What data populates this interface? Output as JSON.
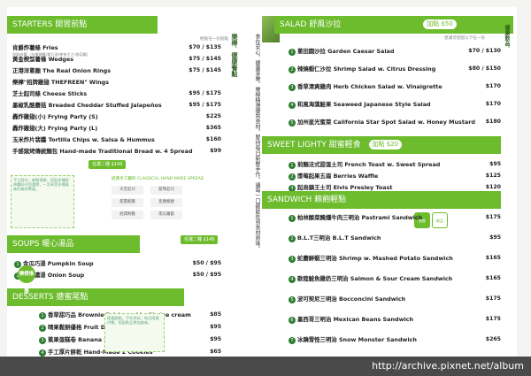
{
  "footer_url": "http://archive.pixnet.net/album",
  "left": {
    "starters": {
      "title": "STARTERS 開胃前點",
      "side_note": "輕點任一份點點",
      "items": [
        {
          "name": "肯爵炸薯條",
          "en": "Fries",
          "price": "$70 / $135",
          "desc": "加點肉醬（辛辣辣醬/美乃滋/麥香主之/香蒜醬）"
        },
        {
          "name": "黃金楔型薯條",
          "en": "Wedges",
          "price": "$75 / $145"
        },
        {
          "name": "正港洋蔥圈",
          "en": "The Real Onion Rings",
          "price": "$75 / $145"
        },
        {
          "name": "樂檸\"招牌雞翅 THEFREEN\" Wings",
          "en": "",
          "price": ""
        },
        {
          "name": "芝士起司條",
          "en": "Cheese Sticks",
          "price": "$95 / $175"
        },
        {
          "name": "墨椒乳酪蘑菇",
          "en": "Breaded Cheddar Stuffed Jalapeños",
          "price": "$95 / $175"
        },
        {
          "name": "轟炸雞翅(小)",
          "en": "Frying Party (S)",
          "price": "$225"
        },
        {
          "name": "轟炸雞翅(大)",
          "en": "Frying Party (L)",
          "price": "$365"
        },
        {
          "name": "玉米炸片翡醬",
          "en": "Tortilla Chips w. Salsa & Hummus",
          "price": "$160"
        },
        {
          "name": "手感窯烤傳統麵包",
          "en": "Hand-made Traditional Bread w. 4 Spread",
          "price": "$99"
        }
      ],
      "combo_label": "任選二種 $149"
    },
    "sauces": {
      "title": "經典手工醬料 CLASSICAL HAND-MADE SPREAD",
      "list": [
        "天堂起司",
        "藍莓起司",
        "甜薑藍醬",
        "焦糖楓糖",
        "經典鮮醬",
        "南瓜蘿蔔"
      ]
    },
    "soups": {
      "title": "SOUPS 暖心湯品",
      "combo_label": "任選二種 $149",
      "items": [
        {
          "name": "金瓜巧湯",
          "en": "Pumpkin Soup",
          "price": "$50 / $95"
        },
        {
          "name": "洋蔥濃湯",
          "en": "Onion Soup",
          "price": "$50 / $95"
        }
      ]
    },
    "desserts": {
      "title": "DESSERTS 搪蜜尾點",
      "items": [
        {
          "name": "香草甜巧品",
          "en": "Brownie Bricks w. Vanilla Ice cream",
          "price": "$85"
        },
        {
          "name": "晴果鬆餅優格",
          "en": "Fruit Dish w. Yogurt",
          "price": "$95"
        },
        {
          "name": "蕉果蛋糕卷",
          "en": "Banana Pound Cake",
          "price": "$95"
        },
        {
          "name": "手工厚片餅乾",
          "en": "Hand-Made 2 Cookies",
          "price": "$65"
        }
      ]
    },
    "badge": "樂檸推薦",
    "page_number": "1"
  },
  "vertical": {
    "title": "樂檸．健康餐點",
    "text": "食在安心，健康享樂。樂檸精選優質食材，堅持每日新鮮手作，讓每一口都能吃到食材原味。"
  },
  "right": {
    "salad": {
      "title": "SALAD 舒風沙拉",
      "combo_label": "加點 $50",
      "side_note": "建議可搭配以下任一份",
      "items": [
        {
          "name": "蔥田園沙拉",
          "en": "Garden Caesar Salad",
          "price": "$70 / $130"
        },
        {
          "name": "辣燒蝦仁沙拉",
          "en": "Shrimp Salad w. Citrus Dressing",
          "price": "$80 / $150"
        },
        {
          "name": "香草清爽雞肉",
          "en": "Herb Chicken Salad w. Vinaigrette",
          "price": "$170"
        },
        {
          "name": "和風海藻鮭果",
          "en": "Seaweed Japanese Style Salad",
          "price": "$170"
        },
        {
          "name": "加州星光蜜菜",
          "en": "California Star Spot Salad w. Honey Mustard",
          "price": "$180"
        }
      ]
    },
    "sweet": {
      "title": "SWEET LIGHTY 甜蜜輕食",
      "combo_label": "加點 $20",
      "items": [
        {
          "name": "煎麵法式甜蛋土司",
          "en": "French Toast w. Sweet Spread",
          "price": "$95"
        },
        {
          "name": "漿莓起果五兩",
          "en": "Berries Waffle",
          "price": "$125"
        },
        {
          "name": "起烏鎮王土司",
          "en": "Elvis Presley Toast",
          "price": "$120"
        }
      ]
    },
    "sandwich": {
      "title": "SANDWICH 賴飽輕點",
      "items": [
        {
          "name": "柏林酸菜醃燻牛肉三明治",
          "en": "Pastrami Sandwich",
          "price": "$175"
        },
        {
          "name": "B.L.T三明治",
          "en": "B.L.T Sandwich",
          "price": "$95"
        },
        {
          "name": "蛇蘑鮮蝦三明治",
          "en": "Shrimp w. Mashed Potato Sandwich",
          "price": "$165"
        },
        {
          "name": "歐陸鮭魚雞奶三明治",
          "en": "Salmon & Sour Cream Sandwich",
          "price": "$165"
        },
        {
          "name": "波可契尼三明治",
          "en": "Bocconcini Sandwich",
          "price": "$175"
        },
        {
          "name": "墨西哥三明治",
          "en": "Mexican Beans Sandwich",
          "price": "$175"
        },
        {
          "name": "冰蹺雪怪三明治",
          "en": "Snow Monster Sandwich",
          "price": "$265"
        }
      ],
      "badges": [
        "新品",
        "熱推"
      ]
    }
  },
  "far_right": {
    "title1": "健康飲品．",
    "title2": "健康首選",
    "text": "樂檸堅持嚴選有機天然食材，每一道餐點皆以健康為出發點，給您最安心的美味饗宴。"
  },
  "colors": {
    "accent": "#6cbc2d",
    "dark_green": "#2e7d32"
  }
}
